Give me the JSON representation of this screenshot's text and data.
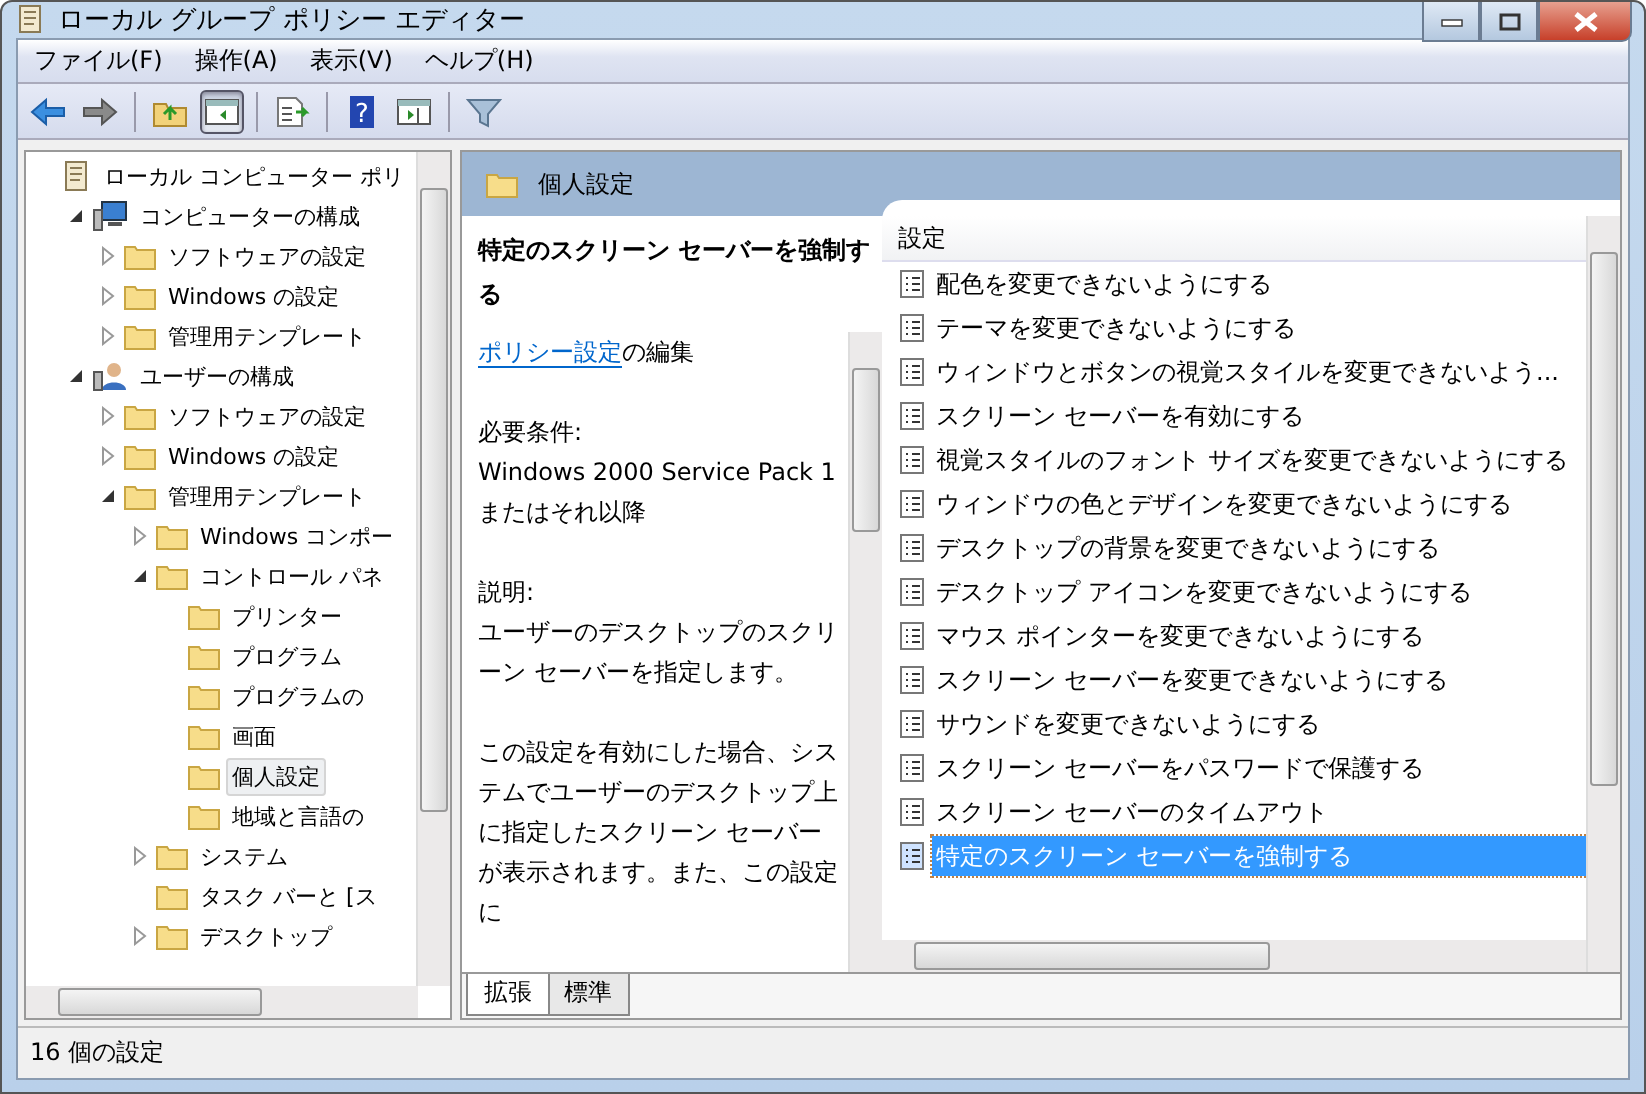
{
  "window": {
    "title": "ローカル グループ ポリシー エディター"
  },
  "menu": [
    "ファイル(F)",
    "操作(A)",
    "表示(V)",
    "ヘルプ(H)"
  ],
  "toolbar": [
    {
      "kind": "back",
      "pressed": false
    },
    {
      "kind": "forward",
      "pressed": false
    },
    {
      "kind": "sep"
    },
    {
      "kind": "up",
      "pressed": false
    },
    {
      "kind": "tree",
      "pressed": true
    },
    {
      "kind": "sep"
    },
    {
      "kind": "export",
      "pressed": false
    },
    {
      "kind": "sep"
    },
    {
      "kind": "help",
      "pressed": false,
      "glyph": "?"
    },
    {
      "kind": "pane",
      "pressed": false
    },
    {
      "kind": "sep"
    },
    {
      "kind": "filter",
      "pressed": false
    }
  ],
  "tree": [
    {
      "label": "ローカル コンピューター ポリ",
      "kind": "scroll",
      "selected": false,
      "children": [
        {
          "label": "コンピューターの構成",
          "kind": "computer",
          "selected": false,
          "expanded": true,
          "children": [
            {
              "label": "ソフトウェアの設定",
              "kind": "folder",
              "selected": false,
              "expanded": false
            },
            {
              "label": "Windows の設定",
              "kind": "folder",
              "selected": false,
              "expanded": false
            },
            {
              "label": "管理用テンプレート",
              "kind": "folder",
              "selected": false,
              "expanded": false
            }
          ]
        },
        {
          "label": "ユーザーの構成",
          "kind": "user",
          "selected": false,
          "expanded": true,
          "children": [
            {
              "label": "ソフトウェアの設定",
              "kind": "folder",
              "selected": false,
              "expanded": false
            },
            {
              "label": "Windows の設定",
              "kind": "folder",
              "selected": false,
              "expanded": false
            },
            {
              "label": "管理用テンプレート",
              "kind": "folder",
              "selected": false,
              "expanded": true,
              "children": [
                {
                  "label": "Windows コンポー",
                  "kind": "folder",
                  "selected": false,
                  "expanded": false
                },
                {
                  "label": "コントロール パネ",
                  "kind": "folder",
                  "selected": false,
                  "expanded": true,
                  "children": [
                    {
                      "label": "プリンター",
                      "kind": "folder",
                      "selected": false
                    },
                    {
                      "label": "プログラム",
                      "kind": "folder",
                      "selected": false
                    },
                    {
                      "label": "プログラムの",
                      "kind": "folder",
                      "selected": false
                    },
                    {
                      "label": "画面",
                      "kind": "folder",
                      "selected": false
                    },
                    {
                      "label": "個人設定",
                      "kind": "folder",
                      "selected": true
                    },
                    {
                      "label": "地域と言語の",
                      "kind": "folder",
                      "selected": false
                    }
                  ]
                },
                {
                  "label": "システム",
                  "kind": "folder",
                  "selected": false,
                  "expanded": false
                },
                {
                  "label": "タスク バーと [ス",
                  "kind": "folder",
                  "selected": false
                },
                {
                  "label": "デスクトップ",
                  "kind": "folder",
                  "selected": false,
                  "expanded": false
                }
              ]
            }
          ]
        }
      ]
    }
  ],
  "header": {
    "title": "個人設定"
  },
  "description": {
    "title": "特定のスクリーン セーバーを強制する",
    "link": "ポリシー設定",
    "link_suffix": "の編集",
    "requirements_label": "必要条件:",
    "requirements": "Windows 2000 Service Pack 1 またはそれ以降",
    "explanation_label": "説明:",
    "explanation": "ユーザーのデスクトップのスクリーン セーバーを指定します。",
    "paragraph": "この設定を有効にした場合、システムでユーザーのデスクトップ上に指定したスクリーン セーバーが表示されます。また、この設定に"
  },
  "list": {
    "column": "設定",
    "rows": [
      {
        "label": "配色を変更できないようにする",
        "selected": false
      },
      {
        "label": "テーマを変更できないようにする",
        "selected": false
      },
      {
        "label": "ウィンドウとボタンの視覚スタイルを変更できないよう...",
        "selected": false
      },
      {
        "label": "スクリーン セーバーを有効にする",
        "selected": false
      },
      {
        "label": "視覚スタイルのフォント サイズを変更できないようにする",
        "selected": false
      },
      {
        "label": "ウィンドウの色とデザインを変更できないようにする",
        "selected": false
      },
      {
        "label": "デスクトップの背景を変更できないようにする",
        "selected": false
      },
      {
        "label": "デスクトップ アイコンを変更できないようにする",
        "selected": false
      },
      {
        "label": "マウス ポインターを変更できないようにする",
        "selected": false
      },
      {
        "label": "スクリーン セーバーを変更できないようにする",
        "selected": false
      },
      {
        "label": "サウンドを変更できないようにする",
        "selected": false
      },
      {
        "label": "スクリーン セーバーをパスワードで保護する",
        "selected": false
      },
      {
        "label": "スクリーン セーバーのタイムアウト",
        "selected": false
      },
      {
        "label": "特定のスクリーン セーバーを強制する",
        "selected": true
      }
    ]
  },
  "tabs": [
    {
      "label": "拡張",
      "selected": true
    },
    {
      "label": "標準",
      "selected": false
    }
  ],
  "status_bar": {
    "text": "16 個の設定"
  }
}
